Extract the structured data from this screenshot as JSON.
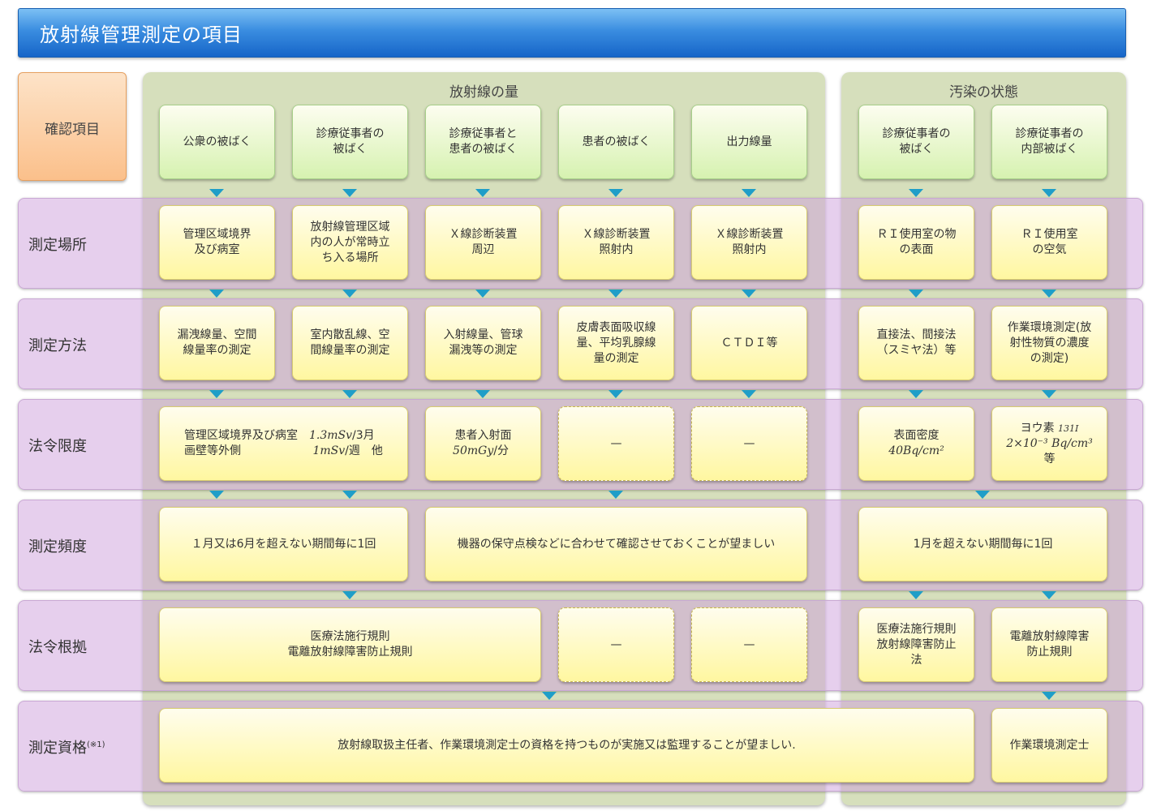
{
  "title": "放射線管理測定の項目",
  "groups": {
    "radiation": "放射線の量",
    "contamination": "汚染の状態"
  },
  "check_item": "確認項目",
  "rows": {
    "place": "測定場所",
    "method": "測定方法",
    "limit": "法令限度",
    "frequency": "測定頻度",
    "basis": "法令根拠",
    "qualification": "測定資格",
    "qualification_note": "(※1)"
  },
  "headers": [
    "公衆の被ばく",
    "診療従事者の\n被ばく",
    "診療従事者と\n患者の被ばく",
    "患者の被ばく",
    "出力線量",
    "診療従事者の\n被ばく",
    "診療従事者の\n内部被ばく"
  ],
  "places": [
    "管理区域境界\n及び病室",
    "放射線管理区域\n内の人が常時立\nち入る場所",
    "Ｘ線診断装置\n周辺",
    "Ｘ線診断装置\n照射内",
    "Ｘ線診断装置\n照射内",
    "ＲＩ使用室の物\nの表面",
    "ＲＩ使用室\nの空気"
  ],
  "methods": [
    "漏洩線量、空間\n線量率の測定",
    "室内散乱線、空\n間線量率の測定",
    "入射線量、管球\n漏洩等の測定",
    "皮膚表面吸収線\n量、平均乳腺線\n量の測定",
    "ＣＴＤＩ等",
    "直接法、間接法\n（スミヤ法）等",
    "作業環境測定(放\n射性物質の濃度\nの測定)"
  ],
  "limits": {
    "c1_left1": "管理区域境界及び病室",
    "c1_left2": "画壁等外側",
    "c1_val1": "1.3mSv",
    "c1_unit1": "/3月",
    "c1_val2": "1mSv",
    "c1_unit2": "/週　他",
    "c3_label": "患者入射面",
    "c3_val": "50mGy",
    "c3_unit": "/分",
    "c4": "—",
    "c5": "—",
    "c6_label": "表面密度",
    "c6_val": "40Bq/cm²",
    "c7_label": "ヨウ素",
    "c7_iso": "131I",
    "c7_val": "2×10⁻³ Bq/cm³",
    "c7_suffix": "等"
  },
  "frequency": {
    "a": "１月又は6月を超えない期間毎に1回",
    "b": "機器の保守点検などに合わせて確認させておくことが望ましい",
    "c": "1月を超えない期間毎に1回"
  },
  "basis": {
    "a": "医療法施行規則\n電離放射線障害防止規則",
    "b": "—",
    "c": "—",
    "d": "医療法施行規則\n放射線障害防止\n法",
    "e": "電離放射線障害\n防止規則"
  },
  "qualification": {
    "a": "放射線取扱主任者、作業環境測定士の資格を持つものが実施又は監理することが望ましい.",
    "b": "作業環境測定士"
  }
}
